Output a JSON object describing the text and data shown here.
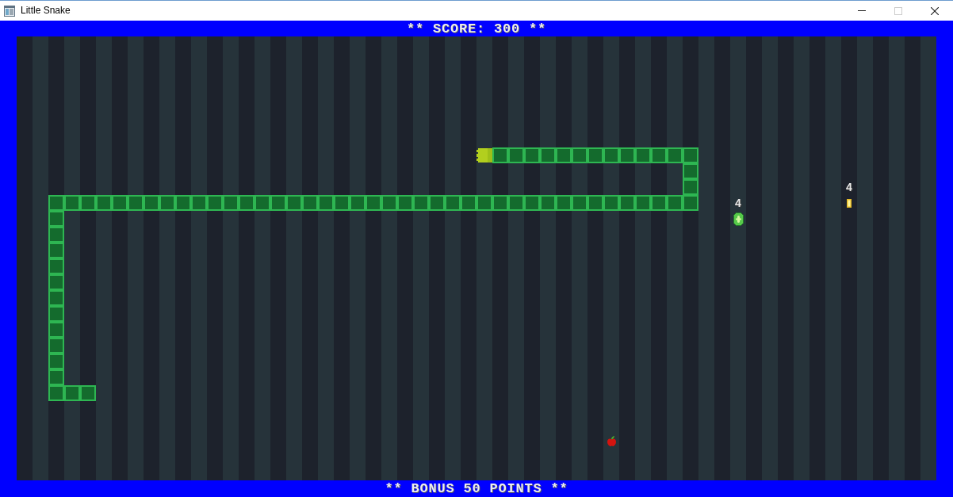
{
  "window": {
    "title": "Little Snake",
    "controls": [
      {
        "kind": "minimize",
        "disabled": false
      },
      {
        "kind": "maximize",
        "disabled": true
      },
      {
        "kind": "close",
        "disabled": false
      }
    ]
  },
  "score_banner": {
    "text": "** SCORE: 300 **"
  },
  "board": {
    "snake": {
      "segments": [
        {
          "kind": "head"
        },
        {
          "kind": "body"
        },
        {
          "kind": "body"
        },
        {
          "kind": "body"
        },
        {
          "kind": "body"
        },
        {
          "kind": "body"
        },
        {
          "kind": "body"
        },
        {
          "kind": "body"
        },
        {
          "kind": "body"
        },
        {
          "kind": "body"
        },
        {
          "kind": "body"
        },
        {
          "kind": "body"
        },
        {
          "kind": "body"
        },
        {
          "kind": "body"
        },
        {
          "kind": "body"
        },
        {
          "kind": "body"
        },
        {
          "kind": "body"
        },
        {
          "kind": "body"
        },
        {
          "kind": "body"
        },
        {
          "kind": "body"
        },
        {
          "kind": "body"
        },
        {
          "kind": "body"
        },
        {
          "kind": "body"
        },
        {
          "kind": "body"
        },
        {
          "kind": "body"
        },
        {
          "kind": "body"
        },
        {
          "kind": "body"
        },
        {
          "kind": "body"
        },
        {
          "kind": "body"
        },
        {
          "kind": "body"
        },
        {
          "kind": "body"
        },
        {
          "kind": "body"
        },
        {
          "kind": "body"
        },
        {
          "kind": "body"
        },
        {
          "kind": "body"
        },
        {
          "kind": "body"
        },
        {
          "kind": "body"
        },
        {
          "kind": "body"
        },
        {
          "kind": "body"
        },
        {
          "kind": "body"
        },
        {
          "kind": "body"
        },
        {
          "kind": "body"
        },
        {
          "kind": "body"
        },
        {
          "kind": "body"
        },
        {
          "kind": "body"
        },
        {
          "kind": "body"
        },
        {
          "kind": "body"
        },
        {
          "kind": "body"
        },
        {
          "kind": "body"
        },
        {
          "kind": "body"
        },
        {
          "kind": "body"
        },
        {
          "kind": "body"
        },
        {
          "kind": "body"
        },
        {
          "kind": "body"
        },
        {
          "kind": "body"
        },
        {
          "kind": "body"
        },
        {
          "kind": "body"
        },
        {
          "kind": "body"
        },
        {
          "kind": "body"
        },
        {
          "kind": "body"
        },
        {
          "kind": "body"
        },
        {
          "kind": "body"
        },
        {
          "kind": "body"
        },
        {
          "kind": "body"
        },
        {
          "kind": "body"
        },
        {
          "kind": "body"
        },
        {
          "kind": "body"
        },
        {
          "kind": "body"
        },
        {
          "kind": "body"
        },
        {
          "kind": "body"
        },
        {
          "kind": "body"
        }
      ]
    },
    "pickups": [
      {
        "kind": "gem",
        "label": "4"
      },
      {
        "kind": "bar",
        "label": "4"
      }
    ],
    "food": [
      {
        "kind": "apple"
      }
    ]
  },
  "bonus_banner": {
    "text": "** BONUS 50 POINTS **"
  }
}
